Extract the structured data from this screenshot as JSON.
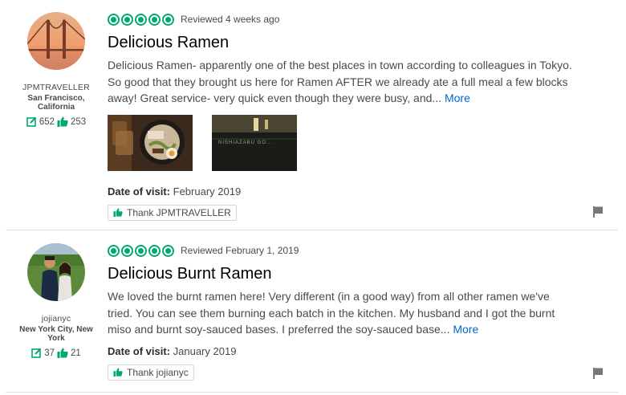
{
  "reviews": [
    {
      "member": {
        "username": "JPMTRAVELLER",
        "location": "San Francisco, California",
        "review_count": "652",
        "helpful_count": "253",
        "avatar_icon": "golden-gate-bridge-avatar"
      },
      "rating_bubbles": 5,
      "review_date": "Reviewed 4 weeks ago",
      "title": "Delicious Ramen",
      "body": "Delicious Ramen- apparently one of the best places in town according to colleagues in Tokyo. So good that they brought us here for Ramen AFTER we already ate a full meal a few blocks away! Great service- very quick even though they were busy, and...",
      "more_label": "More",
      "visit_label": "Date of visit:",
      "visit_date": "February 2019",
      "thank_label": "Thank JPMTRAVELLER",
      "photo_sign_text": "NISHIAZABU GO..."
    },
    {
      "member": {
        "username": "jojianyc",
        "location": "New York City, New York",
        "review_count": "37",
        "helpful_count": "21",
        "avatar_icon": "couple-photo-avatar"
      },
      "rating_bubbles": 5,
      "review_date": "Reviewed February 1, 2019",
      "title": "Delicious Burnt Ramen",
      "body": "We loved the burnt ramen here! Very different (in a good way) from all other ramen we've tried. You can see them burning each batch in the kitchen. My husband and I got the burnt miso and burnt soy-sauced bases. I preferred the soy-sauced base...",
      "more_label": "More",
      "visit_label": "Date of visit:",
      "visit_date": "January 2019",
      "thank_label": "Thank jojianyc"
    }
  ],
  "colors": {
    "bubble_green": "#00aa6c",
    "link_blue": "#0066cc"
  }
}
